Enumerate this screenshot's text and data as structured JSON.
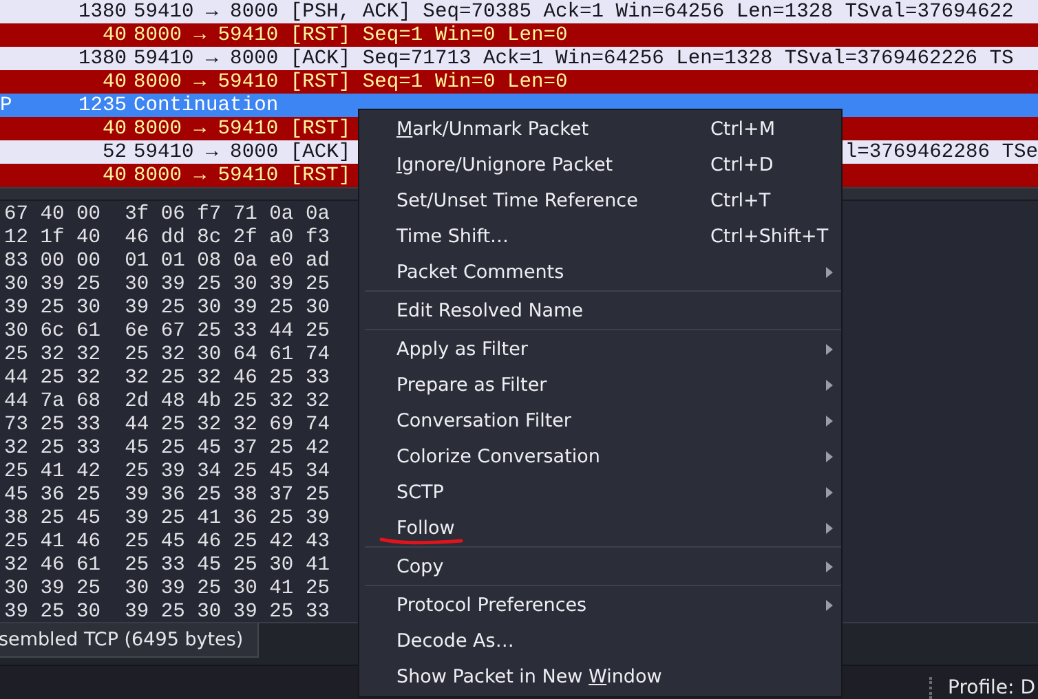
{
  "packet_list": [
    {
      "length": "1380",
      "info": "59410 → 8000 [PSH, ACK] Seq=70385 Ack=1 Win=64256 Len=1328 TSval=37694622",
      "kind": "normal",
      "selected": false
    },
    {
      "length": "40",
      "info": "8000 → 59410 [RST] Seq=1 Win=0 Len=0",
      "kind": "rst",
      "selected": false
    },
    {
      "length": "1380",
      "info": "59410 → 8000 [ACK] Seq=71713 Ack=1 Win=64256 Len=1328 TSval=3769462226 TS",
      "kind": "normal",
      "selected": false
    },
    {
      "length": "40",
      "info": "8000 → 59410 [RST] Seq=1 Win=0 Len=0",
      "kind": "rst",
      "selected": false
    },
    {
      "protocol": "P",
      "length": "1235",
      "info": "Continuation",
      "kind": "normal",
      "selected": true
    },
    {
      "length": "40",
      "info": "8000 → 59410 [RST]",
      "kind": "rst",
      "selected": false
    },
    {
      "length": "52",
      "info": "59410 → 8000 [ACK]",
      "info_tail": "l=3769462286 TSe",
      "kind": "normal",
      "selected": false
    },
    {
      "length": "40",
      "info": "8000 → 59410 [RST]",
      "kind": "rst",
      "selected": false
    }
  ],
  "hex_rows": [
    "67 40 00  3f 06 f7 71 0a 0a",
    "12 1f 40  46 dd 8c 2f a0 f3",
    "83 00 00  01 01 08 0a e0 ad",
    "30 39 25  30 39 25 30 39 25",
    "39 25 30  39 25 30 39 25 30",
    "30 6c 61  6e 67 25 33 44 25",
    "25 32 32  25 32 30 64 61 74",
    "44 25 32  32 25 32 46 25 33",
    "44 7a 68  2d 48 4b 25 32 32",
    "73 25 33  44 25 32 32 69 74",
    "32 25 33  45 25 45 37 25 42",
    "25 41 42  25 39 34 25 45 34",
    "45 36 25  39 36 25 38 37 25",
    "38 25 45  39 25 41 36 25 39",
    "25 41 46  25 45 46 25 42 43",
    "32 46 61  25 33 45 25 30 41",
    "30 39 25  30 39 25 30 41 25",
    "39 25 30  39 25 30 39 25 33"
  ],
  "byte_tabs": [
    {
      "label": "sembled TCP (6495 bytes)"
    }
  ],
  "status_bar": {
    "profile": "Profile: D"
  },
  "context_menu": [
    {
      "kind": "item",
      "key": "M",
      "post": "ark/Unmark Packet",
      "shortcut": "Ctrl+M",
      "submenu": false,
      "annotated": false
    },
    {
      "kind": "item",
      "key": "I",
      "post": "gnore/Unignore Packet",
      "shortcut": "Ctrl+D",
      "submenu": false,
      "annotated": false
    },
    {
      "kind": "item",
      "pre": "Set/Unset Time Reference",
      "shortcut": "Ctrl+T",
      "submenu": false,
      "annotated": false
    },
    {
      "kind": "item",
      "pre": "Time Shift…",
      "shortcut": "Ctrl+Shift+T",
      "submenu": false,
      "annotated": false
    },
    {
      "kind": "item",
      "pre": "Packet Comments",
      "submenu": true,
      "annotated": false
    },
    {
      "kind": "separator"
    },
    {
      "kind": "item",
      "pre": "Edit Resolved Name",
      "submenu": false,
      "annotated": false
    },
    {
      "kind": "separator"
    },
    {
      "kind": "item",
      "pre": "Apply as Filter",
      "submenu": true,
      "annotated": false
    },
    {
      "kind": "item",
      "pre": "Prepare as Filter",
      "submenu": true,
      "annotated": false
    },
    {
      "kind": "item",
      "pre": "Conversation Filter",
      "submenu": true,
      "annotated": false
    },
    {
      "kind": "item",
      "pre": "Colorize Conversation",
      "submenu": true,
      "annotated": false
    },
    {
      "kind": "item",
      "pre": "SCTP",
      "submenu": true,
      "annotated": false
    },
    {
      "kind": "item",
      "pre": "Follow",
      "submenu": true,
      "annotated": true
    },
    {
      "kind": "separator"
    },
    {
      "kind": "item",
      "pre": "Copy",
      "submenu": true,
      "annotated": false
    },
    {
      "kind": "separator"
    },
    {
      "kind": "item",
      "pre": "Protocol Preferences",
      "submenu": true,
      "annotated": false
    },
    {
      "kind": "item",
      "pre": "Decode As…",
      "submenu": false,
      "annotated": false
    },
    {
      "kind": "item",
      "pre": "Show Packet in New ",
      "key": "W",
      "post": "indow",
      "submenu": false,
      "annotated": false
    }
  ]
}
